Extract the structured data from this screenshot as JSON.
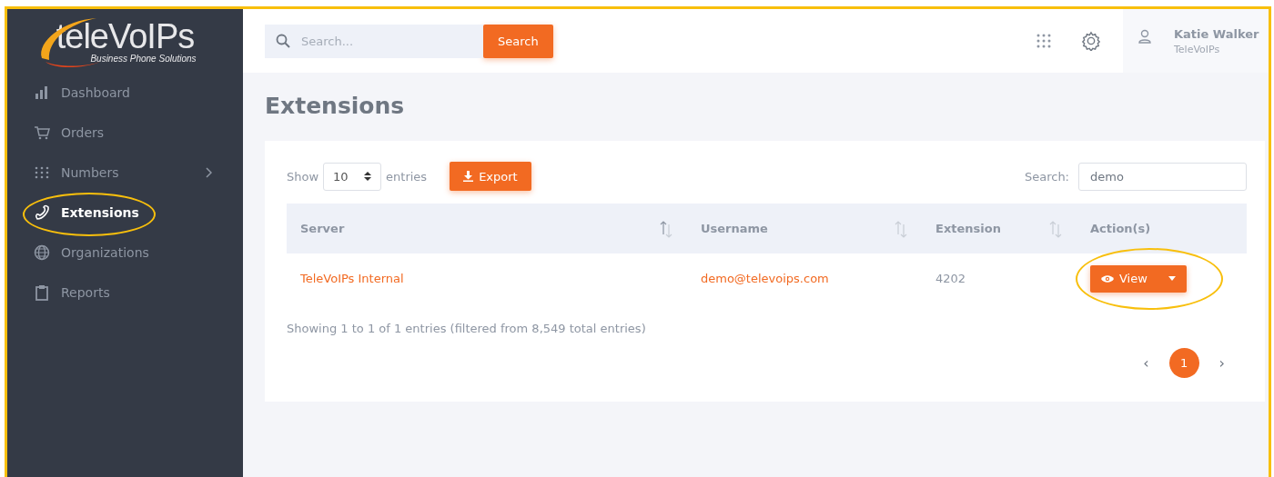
{
  "logo": {
    "name": "teleVoIPs",
    "tagline": "Business Phone Solutions"
  },
  "sidebar": {
    "items": [
      {
        "label": "Dashboard",
        "selected": false,
        "has_submenu": false,
        "circled": false
      },
      {
        "label": "Orders",
        "selected": false,
        "has_submenu": false,
        "circled": false
      },
      {
        "label": "Numbers",
        "selected": false,
        "has_submenu": true,
        "circled": false
      },
      {
        "label": "Extensions",
        "selected": true,
        "has_submenu": false,
        "circled": true
      },
      {
        "label": "Organizations",
        "selected": false,
        "has_submenu": false,
        "circled": false
      },
      {
        "label": "Reports",
        "selected": false,
        "has_submenu": false,
        "circled": false
      }
    ]
  },
  "topbar": {
    "search": {
      "placeholder": "Search...",
      "button": "Search"
    },
    "user": {
      "name": "Katie Walker",
      "organization": "TeleVoIPs"
    }
  },
  "page_title": "Extensions",
  "table_controls": {
    "show_label": "Show",
    "page_size": "10",
    "entries_label": "entries",
    "export_button": "Export",
    "search_label": "Search:",
    "search_value": "demo"
  },
  "table": {
    "columns": [
      {
        "label": "Server",
        "sortable": true
      },
      {
        "label": "Username",
        "sortable": true
      },
      {
        "label": "Extension",
        "sortable": true
      },
      {
        "label": "Action(s)",
        "sortable": false
      }
    ],
    "rows": [
      {
        "server": "TeleVoIPs Internal",
        "username": "demo@televoips.com",
        "extension": "4202",
        "action": "View",
        "circled": true
      }
    ]
  },
  "info": "Showing 1 to 1 of 1 entries (filtered from 8,549 total entries)",
  "pagination": {
    "previous": "‹",
    "next": "›",
    "pages": [
      {
        "label": "1",
        "selected": true
      }
    ]
  }
}
